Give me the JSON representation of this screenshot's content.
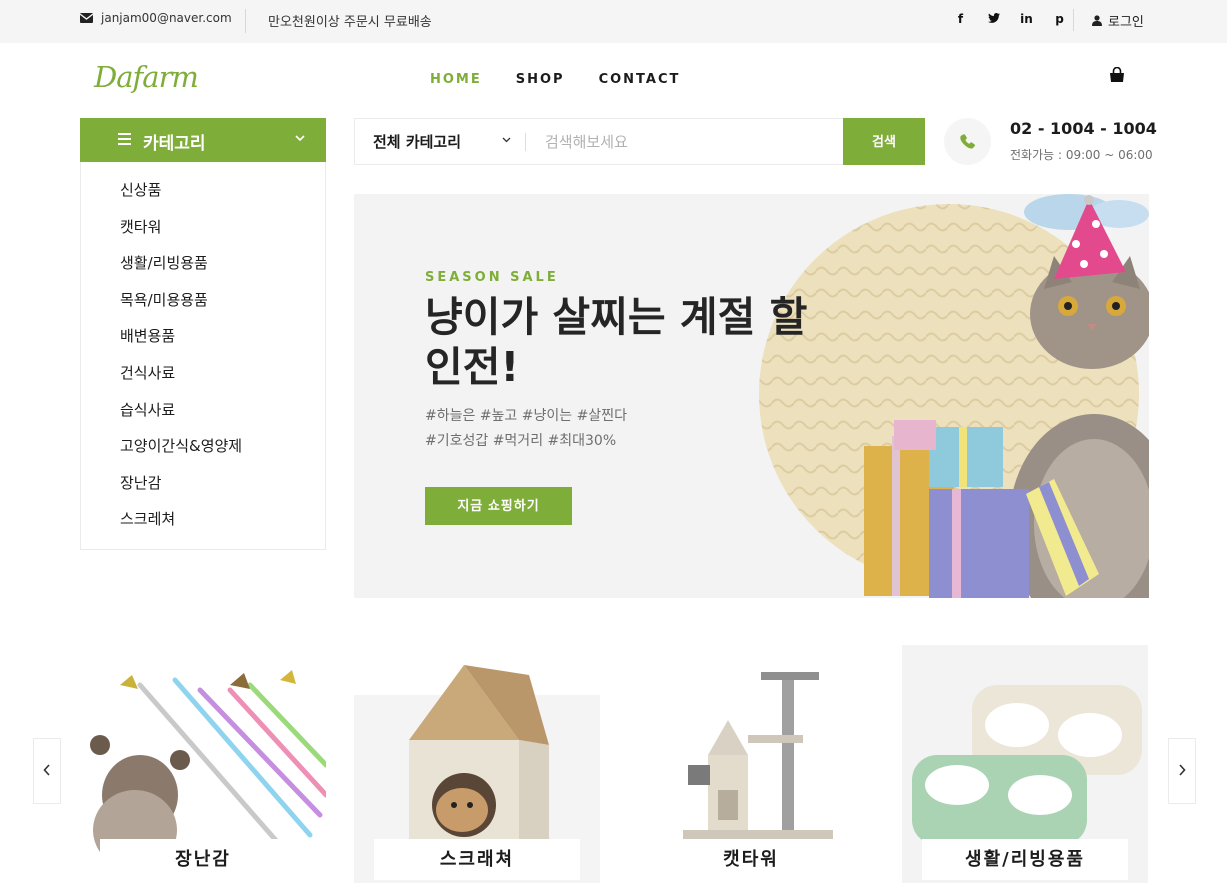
{
  "topbar": {
    "email": "janjam00@naver.com",
    "notice": "만오천원이상 주문시 무료배송",
    "socials": [
      "f",
      "t",
      "in",
      "p"
    ],
    "login": "로그인"
  },
  "header": {
    "logo": "Dafarm",
    "nav": [
      "HOME",
      "SHOP",
      "CONTACT"
    ],
    "active_nav": "HOME"
  },
  "categories": {
    "title": "카테고리",
    "items": [
      "신상품",
      "캣타워",
      "생활/리빙용품",
      "목욕/미용용품",
      "배변용품",
      "건식사료",
      "습식사료",
      "고양이간식&영양제",
      "장난감",
      "스크레쳐"
    ]
  },
  "search": {
    "category": "전체 카테고리",
    "placeholder": "검색해보세요",
    "button": "검색"
  },
  "contact": {
    "phone": "02 - 1004 - 1004",
    "hours": "전화가능 : 09:00 ~ 06:00"
  },
  "hero": {
    "eyebrow": "SEASON SALE",
    "headline": "냥이가 살찌는 계절 할인전!",
    "tags_line1": "#하늘은 #높고 #냥이는 #살찐다",
    "tags_line2": "#기호성갑 #먹거리 #최대30%",
    "button": "지금 쇼핑하기"
  },
  "featured": [
    "장난감",
    "스크래쳐",
    "캣타워",
    "생활/리빙용품"
  ],
  "colors": {
    "accent": "#7fad39",
    "topbar_bg": "#f5f5f5",
    "hero_bg": "#f3f3f3"
  },
  "icons": [
    "envelope-icon",
    "facebook-icon",
    "twitter-icon",
    "linkedin-icon",
    "pinterest-icon",
    "user-icon",
    "cart-icon",
    "menu-icon",
    "chevron-down-icon",
    "phone-icon",
    "chevron-left-icon",
    "chevron-right-icon"
  ]
}
